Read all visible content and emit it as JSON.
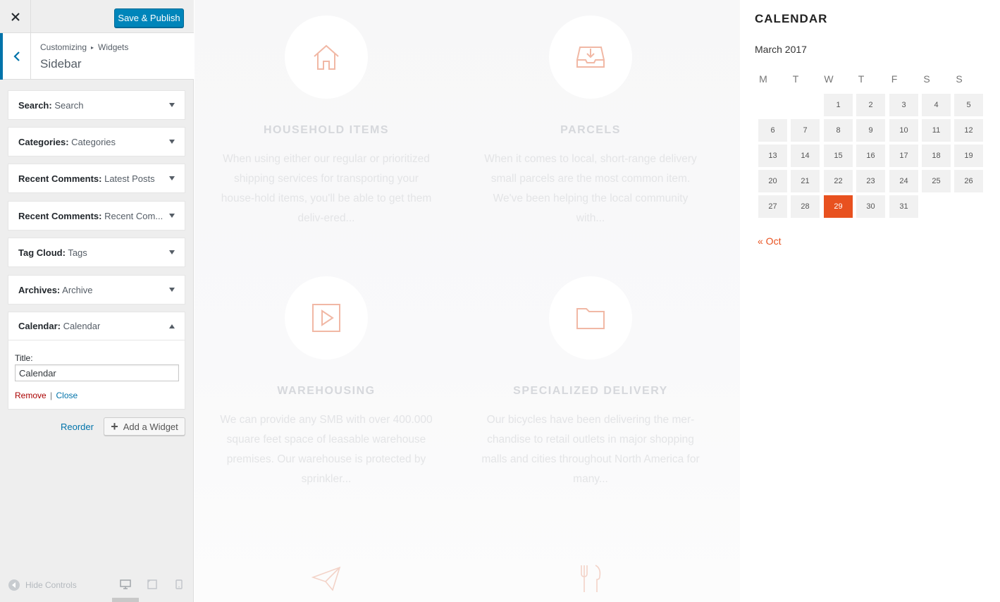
{
  "topbar": {
    "save_label": "Save & Publish"
  },
  "section": {
    "crumb_root": "Customizing",
    "crumb_sep": "▸",
    "crumb_parent": "Widgets",
    "title": "Sidebar"
  },
  "widgets": [
    {
      "type": "Search:",
      "title": "Search"
    },
    {
      "type": "Categories:",
      "title": "Categories"
    },
    {
      "type": "Recent Comments:",
      "title": "Latest Posts"
    },
    {
      "type": "Recent Comments:",
      "title": "Recent Com..."
    },
    {
      "type": "Tag Cloud:",
      "title": "Tags"
    },
    {
      "type": "Archives:",
      "title": "Archive"
    },
    {
      "type": "Calendar:",
      "title": "Calendar"
    }
  ],
  "calendar_form": {
    "title_label": "Title:",
    "title_value": "Calendar",
    "remove_label": "Remove",
    "separator": "|",
    "close_label": "Close"
  },
  "panel_actions": {
    "reorder": "Reorder",
    "add_widget": "Add a Widget"
  },
  "footer": {
    "hide_controls": "Hide Controls"
  },
  "services": [
    {
      "title": "HOUSEHOLD ITEMS",
      "desc": "When using either our regular or prioritized shipping services for transporting your house-hold items, you'll be able to get them deliv-ered...",
      "icon": "house-icon"
    },
    {
      "title": "PARCELS",
      "desc": "When it comes to local, short-range delivery small parcels are the most common item. We've been helping the local community with...",
      "icon": "inbox-tray-icon"
    },
    {
      "title": "WAREHOUSING",
      "desc": "We can provide any SMB with over 400.000 square feet space of leasable warehouse premises. Our warehouse is protected by sprinkler...",
      "icon": "play-box-icon"
    },
    {
      "title": "SPECIALIZED DELIVERY",
      "desc": "Our bicycles have been delivering the mer-chandise to retail outlets in major shopping malls and cities throughout North America for many...",
      "icon": "folder-icon"
    }
  ],
  "calendar": {
    "title": "CALENDAR",
    "caption": "March 2017",
    "weekdays": [
      "M",
      "T",
      "W",
      "T",
      "F",
      "S",
      "S"
    ],
    "first_weekday_index": 2,
    "days_in_month": 31,
    "today": 29,
    "prev_link": "« Oct"
  },
  "colors": {
    "accent": "#e8511f",
    "primary_button": "#0085ba",
    "link": "#0073aa",
    "remove": "#aa0000"
  }
}
